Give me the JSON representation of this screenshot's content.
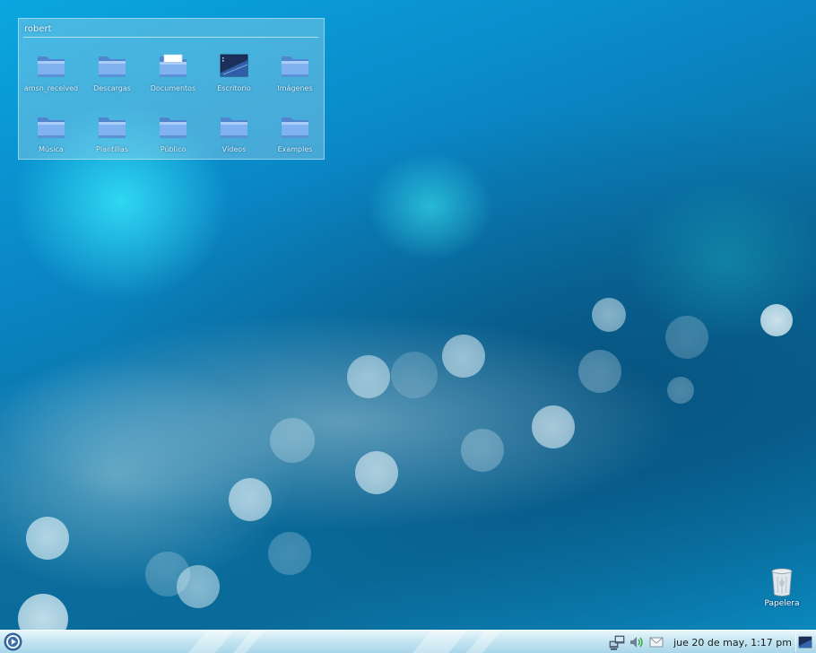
{
  "folder_view": {
    "title": "robert",
    "items": [
      {
        "label": "amsn_received",
        "icon": "folder-icon"
      },
      {
        "label": "Descargas",
        "icon": "folder-icon"
      },
      {
        "label": "Documentos",
        "icon": "folder-documents-icon"
      },
      {
        "label": "Escritorio",
        "icon": "desktop-folder-icon"
      },
      {
        "label": "Imágenes",
        "icon": "folder-icon"
      },
      {
        "label": "Música",
        "icon": "folder-icon"
      },
      {
        "label": "Plantillas",
        "icon": "folder-icon"
      },
      {
        "label": "Público",
        "icon": "folder-icon"
      },
      {
        "label": "Vídeos",
        "icon": "folder-icon"
      },
      {
        "label": "Examples",
        "icon": "folder-icon"
      }
    ]
  },
  "desktop_icons": {
    "trash_label": "Papelera"
  },
  "panel": {
    "clock": "jue 20 de may,  1:17 pm",
    "tray_icons": [
      "network-icon",
      "volume-icon",
      "mail-icon"
    ],
    "menu_icon": "kde-menu-icon",
    "show_desktop_icon": "show-desktop-icon"
  },
  "colors": {
    "wallpaper_base": "#0a87c6",
    "wallpaper_glow": "#3cf0ff",
    "panel": "#c6e6f2",
    "folder_blue": "#6ea8ea"
  }
}
